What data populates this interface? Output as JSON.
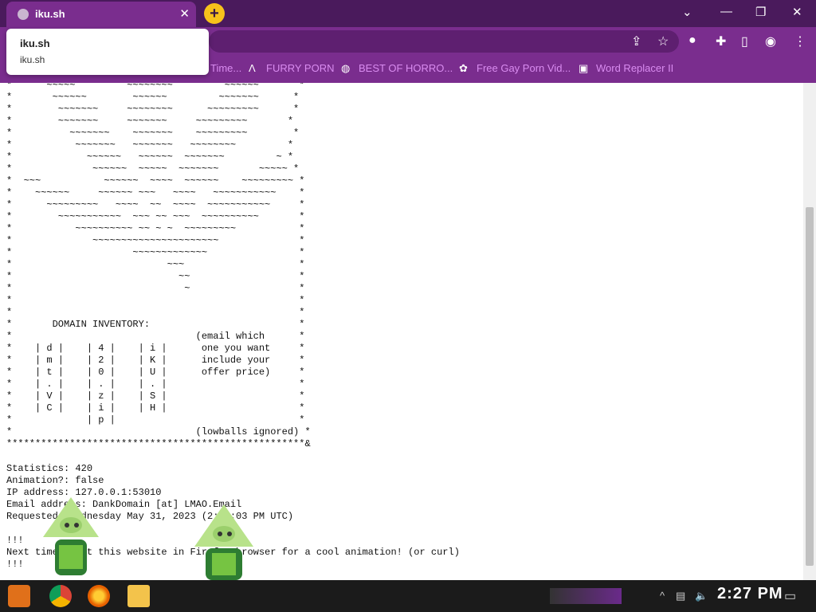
{
  "browser": {
    "tab_title": "iku.sh",
    "new_tab_label": "+",
    "popup_title": "iku.sh",
    "popup_url": "iku.sh",
    "bookmarks": [
      {
        "label": "Time...",
        "icon": "globe-icon"
      },
      {
        "label": "FURRY PORN",
        "icon": "lambda-icon"
      },
      {
        "label": "BEST OF HORRO...",
        "icon": "globe-icon"
      },
      {
        "label": "Free Gay Porn Vid...",
        "icon": "gear-icon"
      },
      {
        "label": "Word Replacer II",
        "icon": "wr-icon"
      }
    ]
  },
  "page": {
    "ascii_lines": [
      "*      ~~~~~         ~~~~~~~~         ~~~~~~       *",
      "*       ~~~~~~        ~~~~~~         ~~~~~~~      *",
      "*        ~~~~~~~     ~~~~~~~~      ~~~~~~~~~      *",
      "*        ~~~~~~~     ~~~~~~~     ~~~~~~~~~       *",
      "*          ~~~~~~~    ~~~~~~~    ~~~~~~~~~        *",
      "*           ~~~~~~~   ~~~~~~~   ~~~~~~~~         *",
      "*             ~~~~~~   ~~~~~~  ~~~~~~~         ~ *",
      "*              ~~~~~~  ~~~~~  ~~~~~~~       ~~~~~ *",
      "*  ~~~           ~~~~~~  ~~~~  ~~~~~~    ~~~~~~~~~ *",
      "*    ~~~~~~     ~~~~~~ ~~~   ~~~~   ~~~~~~~~~~~    *",
      "*      ~~~~~~~~~   ~~~~  ~~  ~~~~  ~~~~~~~~~~~     *",
      "*        ~~~~~~~~~~~  ~~~ ~~ ~~~  ~~~~~~~~~~       *",
      "*           ~~~~~~~~~~ ~~ ~ ~  ~~~~~~~~~           *",
      "*              ~~~~~~~~~~~~~~~~~~~~~~              *",
      "*                     ~~~~~~~~~~~~~                *",
      "*                           ~~~                    *",
      "*                             ~~                   *",
      "*                              ~                   *",
      "*                                                  *",
      "*                                                  *",
      "*       DOMAIN INVENTORY:                          *",
      "*                                (email which      *",
      "*    | d |    | 4 |    | i |      one you want     *",
      "*    | m |    | 2 |    | K |      include your     *",
      "*    | t |    | 0 |    | U |      offer price)     *",
      "*    | . |    | . |    | . |                       *",
      "*    | V |    | z |    | S |                       *",
      "*    | C |    | i |    | H |                       *",
      "*             | p |                                *",
      "*                                (lowballs ignored) *",
      "****************************************************&"
    ],
    "stats": [
      "Statistics: 420",
      "Animation?: false",
      "IP address: 127.0.0.1:53010",
      "Email address: DankDomain [at] LMAO.Email",
      "Requested: Wednesday May 31, 2023 (2:27:03 PM UTC)",
      "",
      "!!!",
      "Next time visit this website in Firefox browser for a cool animation! (or curl)",
      "!!!"
    ]
  },
  "taskbar": {
    "clock": "2:27 PM"
  },
  "colors": {
    "titlebar": "#4a1a5c",
    "toolbar": "#7a2d8e",
    "bookmark_text": "#d98cf0",
    "accent": "#f7c21b"
  }
}
